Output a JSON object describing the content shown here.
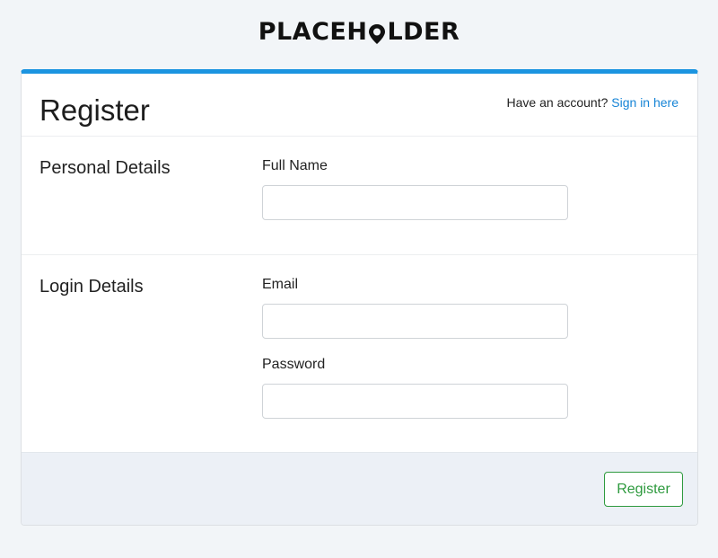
{
  "brand": {
    "logo_text_a": "PLACEH",
    "logo_text_b": "LDER",
    "logo_icon": "map-pin-icon"
  },
  "header": {
    "title": "Register",
    "account_prompt": "Have an account?",
    "signin_link": "Sign in here"
  },
  "sections": {
    "personal": {
      "title": "Personal Details",
      "full_name_label": "Full Name",
      "full_name_value": ""
    },
    "login": {
      "title": "Login Details",
      "email_label": "Email",
      "email_value": "",
      "password_label": "Password",
      "password_value": ""
    }
  },
  "footer": {
    "register_button": "Register"
  },
  "colors": {
    "accent": "#1b94e0",
    "link": "#1684d6",
    "button_green": "#2e9a3e",
    "footer_bg": "#ecf0f6"
  }
}
